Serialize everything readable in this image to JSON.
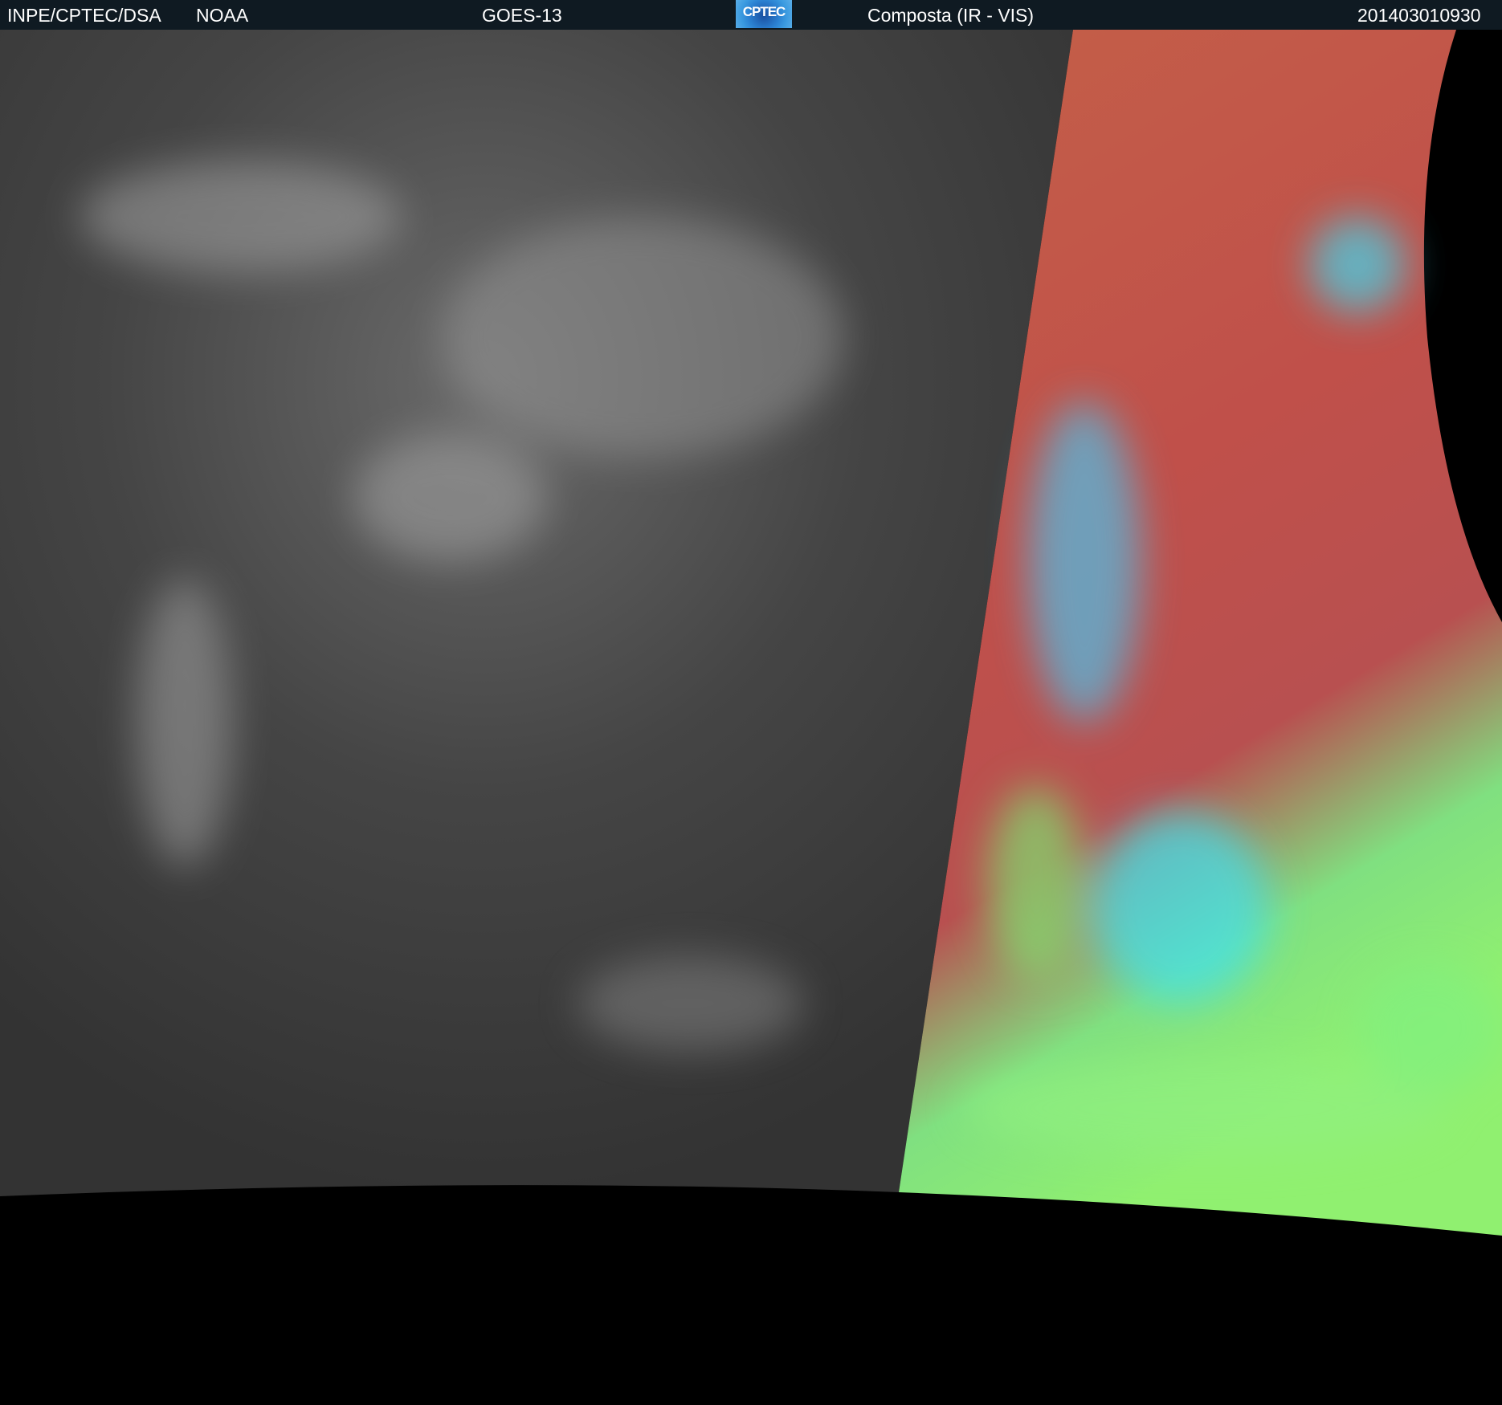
{
  "header": {
    "agency": "INPE/CPTEC/DSA",
    "source": "NOAA",
    "satellite": "GOES-13",
    "logo_text": "CPTEC",
    "product": "Composta (IR - VIS)",
    "timestamp": "201403010930"
  },
  "colors": {
    "header_bg": "#0f1a22",
    "ir_gray": "#3c3c3c",
    "vis_red": "#c0504a",
    "vis_cyan": "#40e0f0",
    "vis_green": "#90f070"
  }
}
